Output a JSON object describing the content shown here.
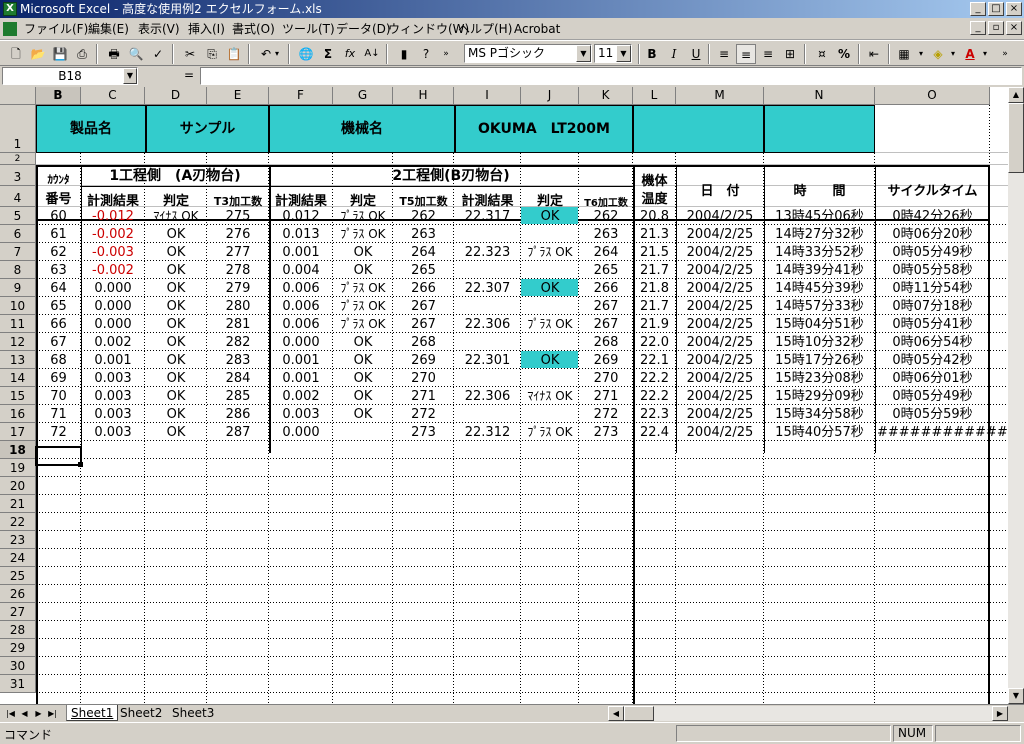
{
  "window": {
    "title": "Microsoft Excel - 高度な使用例2 エクセルフォーム.xls",
    "app_icon": "X"
  },
  "menu": [
    "ファイル(F)",
    "編集(E)",
    "表示(V)",
    "挿入(I)",
    "書式(O)",
    "ツール(T)",
    "データ(D)",
    "ウィンドウ(W)",
    "ヘルプ(H)",
    "Acrobat"
  ],
  "toolbar": {
    "font_name": "MS Pゴシック",
    "font_size": "11",
    "bold": "B",
    "italic": "I",
    "underline": "U",
    "sum": "Σ",
    "fx": "fx",
    "percent": "%"
  },
  "formula": {
    "name_box": "B18",
    "equals": "=",
    "content": ""
  },
  "columns": [
    "B",
    "C",
    "D",
    "E",
    "F",
    "G",
    "H",
    "I",
    "J",
    "K",
    "L",
    "M",
    "N",
    "O"
  ],
  "rows": [
    "1",
    "2",
    "3",
    "4",
    "5",
    "6",
    "7",
    "8",
    "9",
    "10",
    "11",
    "12",
    "13",
    "14",
    "15",
    "16",
    "17",
    "18",
    "19",
    "20",
    "21",
    "22",
    "23",
    "24",
    "25",
    "26",
    "27",
    "28",
    "29",
    "30",
    "31"
  ],
  "header": {
    "product": "製品名",
    "sample": "サンプル",
    "machine": "機械名",
    "machine_name": "OKUMA　LT200M",
    "counter_top": "ｶｳﾝﾀ",
    "counter_bot": "番号",
    "proc1": "1工程側　(A刃物台)",
    "proc2": "2工程側(B刃物台)",
    "measure": "計測結果",
    "judge": "判定",
    "t3": "T3加工数",
    "t5": "T5加工数",
    "t6": "T6加工数",
    "temp_top": "機体",
    "temp_bot": "温度",
    "date": "日　付",
    "time": "時　　間",
    "cycle": "サイクルタイム"
  },
  "data": [
    [
      "60",
      "-0.012",
      "ﾏｲﾅｽ OK",
      "275",
      "0.012",
      "ﾌﾟﾗｽ OK",
      "262",
      "22.317",
      "OK",
      "262",
      "20.8",
      "2004/2/25",
      "13時45分06秒",
      "0時42分26秒"
    ],
    [
      "61",
      "-0.002",
      "OK",
      "276",
      "0.013",
      "ﾌﾟﾗｽ OK",
      "263",
      "",
      "",
      "263",
      "21.3",
      "2004/2/25",
      "14時27分32秒",
      "0時06分20秒"
    ],
    [
      "62",
      "-0.003",
      "OK",
      "277",
      "0.001",
      "OK",
      "264",
      "22.323",
      "ﾌﾟﾗｽ OK",
      "264",
      "21.5",
      "2004/2/25",
      "14時33分52秒",
      "0時05分49秒"
    ],
    [
      "63",
      "-0.002",
      "OK",
      "278",
      "0.004",
      "OK",
      "265",
      "",
      "",
      "265",
      "21.7",
      "2004/2/25",
      "14時39分41秒",
      "0時05分58秒"
    ],
    [
      "64",
      "0.000",
      "OK",
      "279",
      "0.006",
      "ﾌﾟﾗｽ OK",
      "266",
      "22.307",
      "OK",
      "266",
      "21.8",
      "2004/2/25",
      "14時45分39秒",
      "0時11分54秒"
    ],
    [
      "65",
      "0.000",
      "OK",
      "280",
      "0.006",
      "ﾌﾟﾗｽ OK",
      "267",
      "",
      "",
      "267",
      "21.7",
      "2004/2/25",
      "14時57分33秒",
      "0時07分18秒"
    ],
    [
      "66",
      "0.000",
      "OK",
      "281",
      "0.006",
      "ﾌﾟﾗｽ OK",
      "267",
      "22.306",
      "ﾌﾟﾗｽ OK",
      "267",
      "21.9",
      "2004/2/25",
      "15時04分51秒",
      "0時05分41秒"
    ],
    [
      "67",
      "0.002",
      "OK",
      "282",
      "0.000",
      "OK",
      "268",
      "",
      "",
      "268",
      "22.0",
      "2004/2/25",
      "15時10分32秒",
      "0時06分54秒"
    ],
    [
      "68",
      "0.001",
      "OK",
      "283",
      "0.001",
      "OK",
      "269",
      "22.301",
      "OK",
      "269",
      "22.1",
      "2004/2/25",
      "15時17分26秒",
      "0時05分42秒"
    ],
    [
      "69",
      "0.003",
      "OK",
      "284",
      "0.001",
      "OK",
      "270",
      "",
      "",
      "270",
      "22.2",
      "2004/2/25",
      "15時23分08秒",
      "0時06分01秒"
    ],
    [
      "70",
      "0.003",
      "OK",
      "285",
      "0.002",
      "OK",
      "271",
      "22.306",
      "ﾏｲﾅｽ OK",
      "271",
      "22.2",
      "2004/2/25",
      "15時29分09秒",
      "0時05分49秒"
    ],
    [
      "71",
      "0.003",
      "OK",
      "286",
      "0.003",
      "OK",
      "272",
      "",
      "",
      "272",
      "22.3",
      "2004/2/25",
      "15時34分58秒",
      "0時05分59秒"
    ],
    [
      "72",
      "0.003",
      "OK",
      "287",
      "0.000",
      "",
      "273",
      "22.312",
      "ﾌﾟﾗｽ OK",
      "273",
      "22.4",
      "2004/2/25",
      "15時40分57秒",
      "############"
    ]
  ],
  "ok_highlight_rows": [
    0,
    4,
    8
  ],
  "negative_rows": [
    0,
    1,
    2,
    3
  ],
  "colors": {
    "header_band": "#33cccc",
    "negative": "#cc0000",
    "title_gradient_start": "#0a246a"
  },
  "sheets": [
    "Sheet1",
    "Sheet2",
    "Sheet3"
  ],
  "status": {
    "mode": "コマンド",
    "num": "NUM"
  }
}
